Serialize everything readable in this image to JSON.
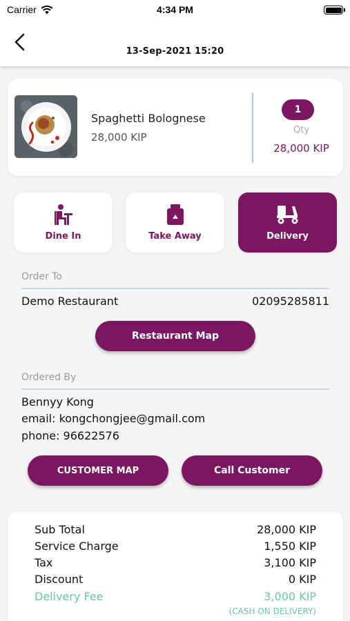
{
  "status_bar": {
    "carrier": "Carrier",
    "time": "4:34 PM"
  },
  "header": {
    "datetime": "13-Sep-2021  15:20"
  },
  "order_item": {
    "name": "Spaghetti Bolognese",
    "price": "28,000 KIP",
    "qty": "1",
    "qty_label": "Qty",
    "total": "28,000 KIP"
  },
  "order_types": [
    {
      "label": "Dine In",
      "icon": "dine-in-icon",
      "active": false
    },
    {
      "label": "Take Away",
      "icon": "take-away-bag-icon",
      "active": false
    },
    {
      "label": "Delivery",
      "icon": "delivery-scooter-icon",
      "active": true
    }
  ],
  "order_to": {
    "label": "Order To",
    "restaurant": "Demo Restaurant",
    "phone": "02095285811",
    "map_button": "Restaurant Map"
  },
  "ordered_by": {
    "label": "Ordered By",
    "name": "Bennyy Kong",
    "email": "email: kongchongjee@gmail.com",
    "phone": "phone: 96622576",
    "customer_map_button": "CUSTOMER MAP",
    "call_button": "Call Customer"
  },
  "summary": {
    "rows": [
      {
        "label": "Sub Total",
        "value": "28,000 KIP"
      },
      {
        "label": "Service Charge",
        "value": "1,550 KIP"
      },
      {
        "label": "Tax",
        "value": "3,100 KIP"
      },
      {
        "label": "Discount",
        "value": "0 KIP"
      },
      {
        "label": "Delivery Fee",
        "value": "3,000 KIP"
      }
    ],
    "payment_note": "(CASH ON DELIVERY)"
  },
  "colors": {
    "accent": "#7b1660",
    "fee": "#6cc3b0",
    "divider": "#c6d3e2"
  }
}
